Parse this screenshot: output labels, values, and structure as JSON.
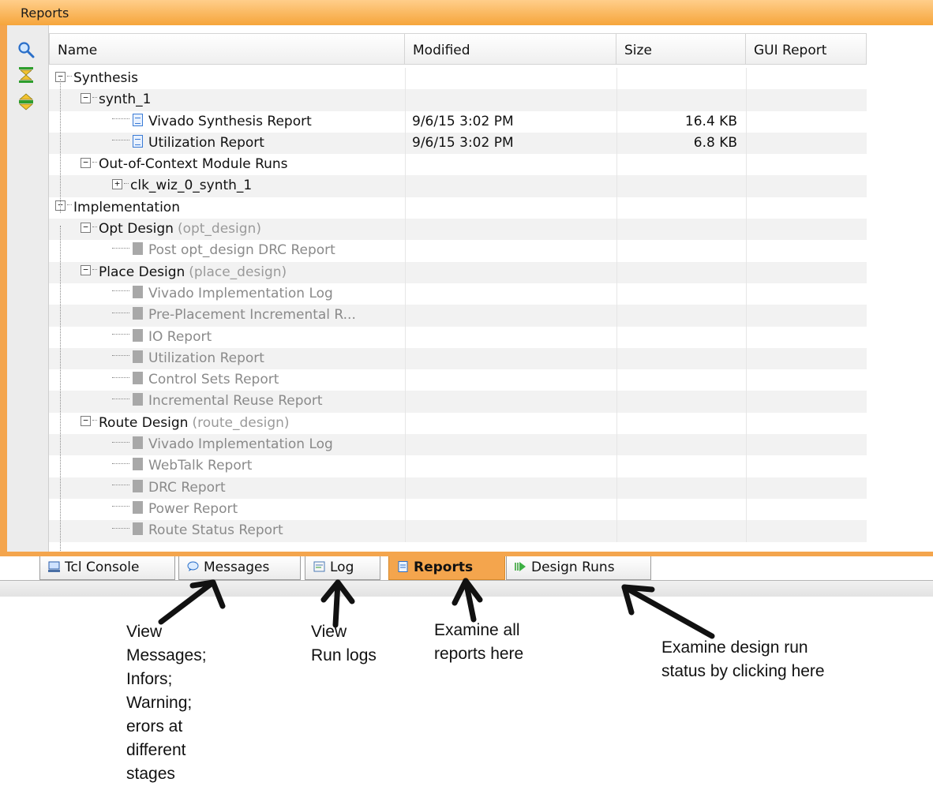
{
  "panel": {
    "title": "Reports"
  },
  "toolbar": {
    "icons": [
      "search-icon",
      "collapse-all-icon",
      "expand-all-icon"
    ]
  },
  "columns": {
    "name": "Name",
    "modified": "Modified",
    "size": "Size",
    "gui_report": "GUI Report"
  },
  "rows": [
    {
      "name": "Synthesis",
      "kind": "group",
      "level": 0,
      "expander": "−"
    },
    {
      "name": "synth_1",
      "kind": "group",
      "level": 1,
      "expander": "−"
    },
    {
      "name": "Vivado Synthesis Report",
      "kind": "report",
      "level": 2,
      "modified": "9/6/15 3:02 PM",
      "size": "16.4 KB",
      "enabled": true
    },
    {
      "name": "Utilization Report",
      "kind": "report",
      "level": 2,
      "modified": "9/6/15 3:02 PM",
      "size": "6.8 KB",
      "enabled": true
    },
    {
      "name": "Out-of-Context Module Runs",
      "kind": "group",
      "level": 1,
      "expander": "−"
    },
    {
      "name": "clk_wiz_0_synth_1",
      "kind": "group",
      "level": 2,
      "expander": "+"
    },
    {
      "name": "Implementation",
      "kind": "group",
      "level": 0,
      "expander": "−"
    },
    {
      "name": "Opt Design",
      "sub": "(opt_design)",
      "kind": "group",
      "level": 1,
      "expander": "−"
    },
    {
      "name": "Post opt_design DRC Report",
      "kind": "report",
      "level": 2,
      "enabled": false
    },
    {
      "name": "Place Design",
      "sub": "(place_design)",
      "kind": "group",
      "level": 1,
      "expander": "−"
    },
    {
      "name": "Vivado Implementation Log",
      "kind": "report",
      "level": 2,
      "enabled": false
    },
    {
      "name": "Pre-Placement Incremental R...",
      "kind": "report",
      "level": 2,
      "enabled": false
    },
    {
      "name": "IO Report",
      "kind": "report",
      "level": 2,
      "enabled": false
    },
    {
      "name": "Utilization Report",
      "kind": "report",
      "level": 2,
      "enabled": false
    },
    {
      "name": "Control Sets Report",
      "kind": "report",
      "level": 2,
      "enabled": false
    },
    {
      "name": "Incremental Reuse Report",
      "kind": "report",
      "level": 2,
      "enabled": false
    },
    {
      "name": "Route Design",
      "sub": "(route_design)",
      "kind": "group",
      "level": 1,
      "expander": "−"
    },
    {
      "name": "Vivado Implementation Log",
      "kind": "report",
      "level": 2,
      "enabled": false
    },
    {
      "name": "WebTalk Report",
      "kind": "report",
      "level": 2,
      "enabled": false
    },
    {
      "name": "DRC Report",
      "kind": "report",
      "level": 2,
      "enabled": false
    },
    {
      "name": "Power Report",
      "kind": "report",
      "level": 2,
      "enabled": false
    },
    {
      "name": "Route Status Report",
      "kind": "report",
      "level": 2,
      "enabled": false
    }
  ],
  "tabs": [
    {
      "label": "Tcl Console",
      "icon": "console-icon",
      "active": false
    },
    {
      "label": "Messages",
      "icon": "speech-bubble-icon",
      "active": false
    },
    {
      "label": "Log",
      "icon": "log-icon",
      "active": false
    },
    {
      "label": "Reports",
      "icon": "document-icon",
      "active": true
    },
    {
      "label": "Design Runs",
      "icon": "run-arrow-icon",
      "active": false
    }
  ],
  "annotations": {
    "messages": [
      "View",
      "Messages;",
      "Infors;",
      "Warning;",
      "erors at",
      "different",
      "stages"
    ],
    "log": [
      "View",
      "Run logs"
    ],
    "reports": [
      "Examine all",
      "reports here"
    ],
    "design_runs": [
      "Examine design run",
      "status by clicking here"
    ]
  },
  "colors": {
    "accent": "#f4a54d",
    "title_gradient_top": "#ffce8a",
    "link_blue": "#3a7bd5"
  }
}
